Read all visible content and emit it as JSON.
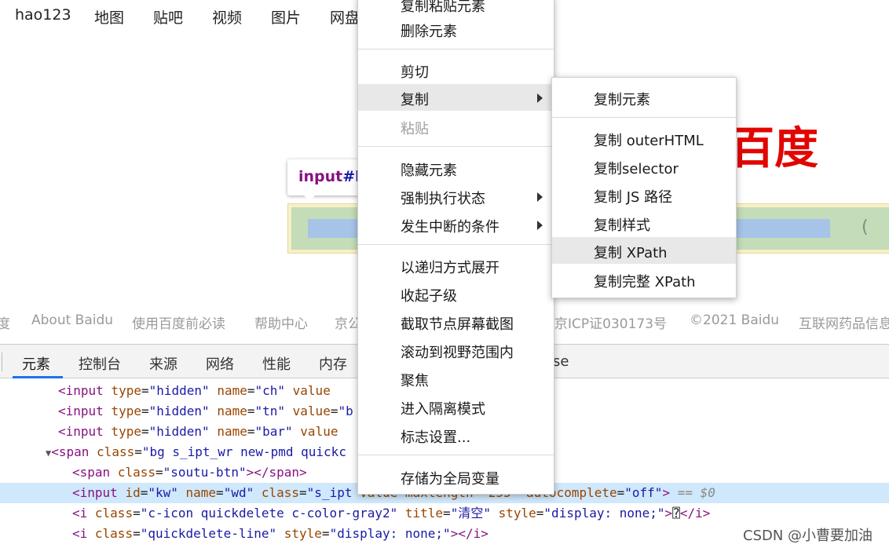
{
  "topnav": [
    "hao123",
    "地图",
    "贴吧",
    "视频",
    "图片",
    "网盘"
  ],
  "logo_text": "百度",
  "tooltip": {
    "tag": "input",
    "id_part": "#kw"
  },
  "search_cut_glyph": "(",
  "footer": [
    "度",
    "About Baidu",
    "使用百度前必读",
    "帮助中心",
    "京公",
    "京ICP证030173号",
    "©2021 Baidu",
    "互联网药品信息"
  ],
  "devtools": {
    "tabs": [
      "元素",
      "控制台",
      "来源",
      "网络",
      "性能",
      "内存"
    ],
    "tab_fragment": "se",
    "active_tab": "元素"
  },
  "code": {
    "l1": {
      "tag": "<input",
      "a1": "type",
      "v1": "\"hidden\"",
      "a2": "name",
      "v2": "\"ch\"",
      "a3": "value"
    },
    "l2": {
      "tag": "<input",
      "a1": "type",
      "v1": "\"hidden\"",
      "a2": "name",
      "v2": "\"tn\"",
      "a3": "value",
      "v3": "\"b"
    },
    "l3": {
      "tag": "<input",
      "a1": "type",
      "v1": "\"hidden\"",
      "a2": "name",
      "v2": "\"bar\"",
      "a3": "value"
    },
    "l4": {
      "tag": "<span",
      "a1": "class",
      "v1": "\"bg s_ipt_wr new-pmd quickc"
    },
    "l5": {
      "tag": "<span",
      "a1": "class",
      "v1": "\"soutu-btn\"",
      "close": "></span>"
    },
    "l6": {
      "tag": "<input",
      "a1": "id",
      "v1": "\"kw\"",
      "a2": "name",
      "v2": "\"wd\"",
      "a3": "class",
      "v3": "\"s_ipt",
      "hidden": " value maxlength=\"255\" ",
      "a4": "autocomplete",
      "v4": "\"off\"",
      "close": ">",
      "eq": " == $0"
    },
    "l7": {
      "tag": "<i",
      "a1": "class",
      "v1": "\"c-icon quickdelete c-color-gray2\"",
      "a2": "title",
      "v2": "\"清空\"",
      "a3": "style",
      "v3": "\"display: none;\"",
      "close": ">",
      "glyph": "⍰",
      "end": "</i>"
    },
    "l8": {
      "tag": "<i",
      "a1": "class",
      "v1": "\"quickdelete-line\"",
      "a2": "style",
      "v2": "\"display: none;\"",
      "close": "></i>"
    }
  },
  "watermark": "CSDN @小曹要加油",
  "context_menu": {
    "items": [
      {
        "label": "复制粘贴元素",
        "enabled": true
      },
      {
        "label": "删除元素",
        "enabled": true
      },
      {
        "label": "剪切",
        "enabled": true
      },
      {
        "label": "复制",
        "enabled": true,
        "highlighted": true,
        "submenu": true
      },
      {
        "label": "粘贴",
        "enabled": false
      },
      {
        "label": "隐藏元素",
        "enabled": true
      },
      {
        "label": "强制执行状态",
        "enabled": true,
        "submenu": true
      },
      {
        "label": "发生中断的条件",
        "enabled": true,
        "submenu": true
      },
      {
        "label": "以递归方式展开",
        "enabled": true
      },
      {
        "label": "收起子级",
        "enabled": true
      },
      {
        "label": "截取节点屏幕截图",
        "enabled": true
      },
      {
        "label": "滚动到视野范围内",
        "enabled": true
      },
      {
        "label": "聚焦",
        "enabled": true
      },
      {
        "label": "进入隔离模式",
        "enabled": true
      },
      {
        "label": "标志设置...",
        "enabled": true
      },
      {
        "label": "存储为全局变量",
        "enabled": true
      }
    ]
  },
  "copy_submenu": {
    "items": [
      {
        "label": "复制元素"
      },
      {
        "label": "复制 outerHTML"
      },
      {
        "label": "复制selector"
      },
      {
        "label": "复制 JS 路径"
      },
      {
        "label": "复制样式"
      },
      {
        "label": "复制 XPath",
        "highlighted": true
      },
      {
        "label": "复制完整 XPath"
      }
    ]
  }
}
